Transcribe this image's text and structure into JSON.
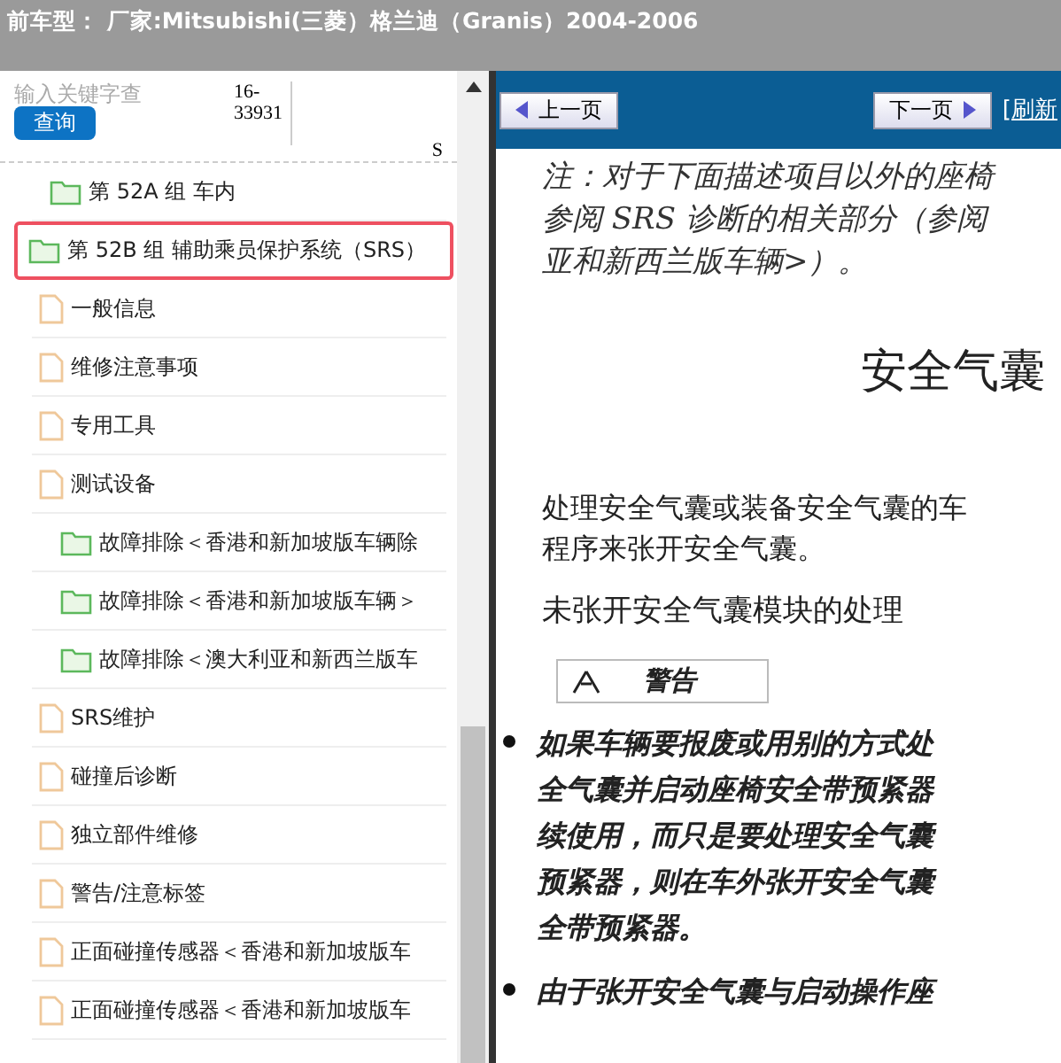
{
  "header": {
    "title": "前车型：  厂家:Mitsubishi(三菱）格兰迪（Granis）2004-2006"
  },
  "search": {
    "placeholder": "输入关键字查",
    "button": "查询",
    "code": "16-\n33931",
    "column_3": "S"
  },
  "tree": [
    {
      "kind": "folder",
      "label": "第 52A 组 车内",
      "selected": false
    },
    {
      "kind": "folder",
      "label": "第 52B 组 辅助乘员保护系统（SRS）",
      "selected": true
    },
    {
      "kind": "page",
      "label": "一般信息",
      "selected": false
    },
    {
      "kind": "page",
      "label": "维修注意事项",
      "selected": false
    },
    {
      "kind": "page",
      "label": "专用工具",
      "selected": false
    },
    {
      "kind": "page",
      "label": "测试设备",
      "selected": false,
      "children": [
        {
          "kind": "folder",
          "label": "故障排除＜香港和新加坡版车辆除",
          "selected": false
        },
        {
          "kind": "folder",
          "label": "故障排除＜香港和新加坡版车辆＞",
          "selected": false
        },
        {
          "kind": "folder",
          "label": "故障排除＜澳大利亚和新西兰版车",
          "selected": false
        }
      ]
    },
    {
      "kind": "page",
      "label": "SRS维护",
      "selected": false
    },
    {
      "kind": "page",
      "label": "碰撞后诊断",
      "selected": false
    },
    {
      "kind": "page",
      "label": "独立部件维修",
      "selected": false
    },
    {
      "kind": "page",
      "label": "警告/注意标签",
      "selected": false
    },
    {
      "kind": "page",
      "label": "正面碰撞传感器＜香港和新加坡版车",
      "selected": false
    },
    {
      "kind": "page",
      "label": "正面碰撞传感器＜香港和新加坡版车",
      "selected": false
    }
  ],
  "nav": {
    "prev": "上一页",
    "next": "下一页",
    "refresh": "[刷新"
  },
  "document": {
    "note_lines": [
      "注：对于下面描述项目以外的座椅",
      "参阅 SRS 诊断的相关部分（参阅",
      "亚和新西兰版车辆>）。"
    ],
    "title": "安全气囊",
    "intro_lines": [
      "处理安全气囊或装备安全气囊的车",
      "程序来张开安全气囊。"
    ],
    "subtitle": "未张开安全气囊模块的处理",
    "warning": "警告",
    "bullets": [
      [
        "如果车辆要报废或用别的方式处",
        "全气囊并启动座椅安全带预紧器",
        "续使用，而只是要处理安全气囊",
        "预紧器，则在车外张开安全气囊",
        "全带预紧器。"
      ],
      [
        "由于张开安全气囊与启动操作座"
      ]
    ]
  }
}
